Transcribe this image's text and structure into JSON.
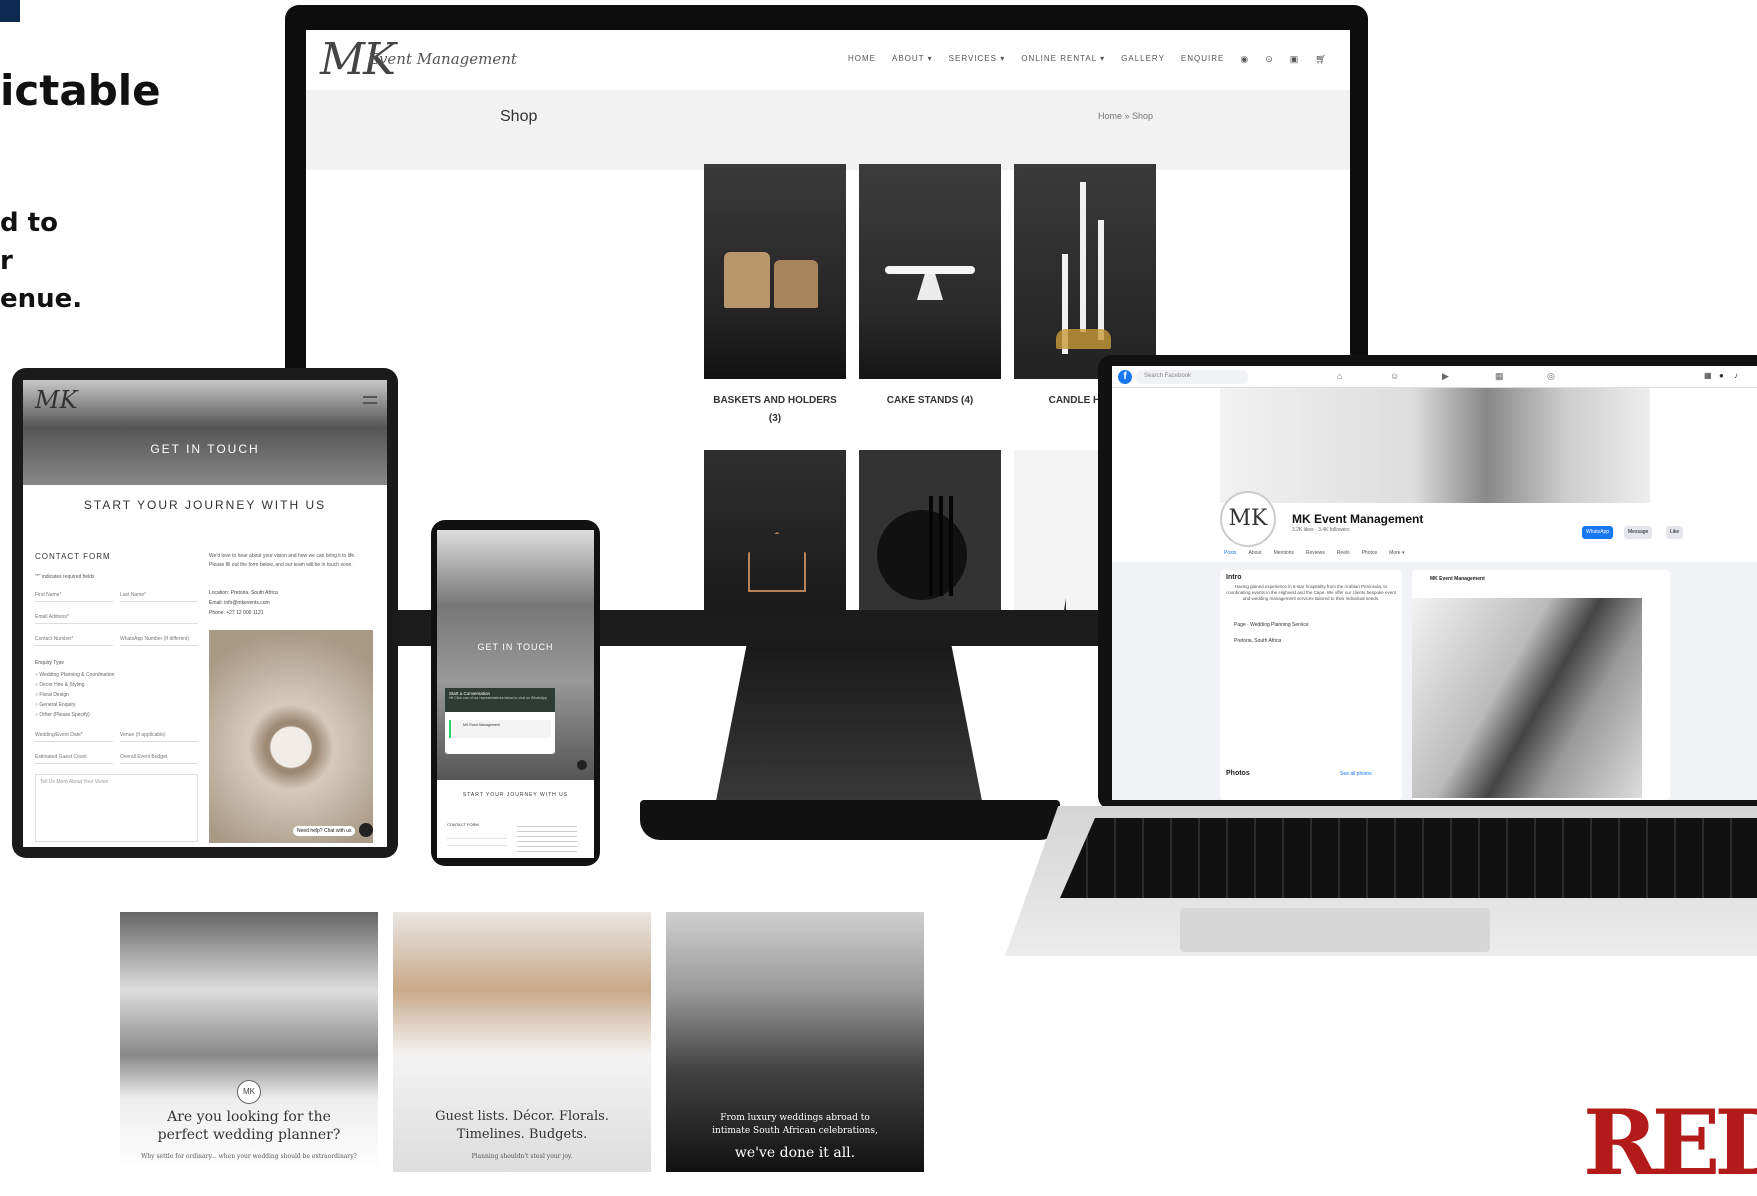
{
  "headline": {
    "line1": "ictable",
    "line2": "d to",
    "line3": "r",
    "line4": "enue."
  },
  "monitor": {
    "logo_mk": "MK",
    "logo_text": "Event Management",
    "nav": [
      "HOME",
      "ABOUT ▾",
      "SERVICES ▾",
      "ONLINE RENTAL ▾",
      "GALLERY",
      "ENQUIRE"
    ],
    "nav_icons": [
      "instagram-icon",
      "pinterest-icon",
      "youtube-icon",
      "cart-icon"
    ],
    "page_title": "Shop",
    "breadcrumb": "Home » Shop",
    "products": [
      {
        "label": "BASKETS AND HOLDERS",
        "count": "(3)"
      },
      {
        "label": "CAKE STANDS (4)"
      },
      {
        "label": "CANDLE HOLD"
      }
    ]
  },
  "facebook": {
    "search_placeholder": "Search Facebook",
    "page_name": "MK Event Management",
    "page_stats": "3.2K likes · 3.4K followers",
    "buttons": [
      "WhatsApp",
      "Message",
      "Like"
    ],
    "tabs": [
      "Posts",
      "About",
      "Mentions",
      "Reviews",
      "Reels",
      "Photos",
      "More ▾"
    ],
    "intro_title": "Intro",
    "intro_text": "Having gained experience in 5-star hospitality from the Arabian Peninsula, to coordinating events in the Highveld and the Cape. We offer our clients bespoke event and wedding management services tailored to their individual needs.",
    "intro_items": [
      "Page · Wedding Planning Service",
      "Pretoria, South Africa"
    ],
    "photos_label": "Photos",
    "see_all": "See all photos",
    "post_author": "MK Event Management",
    "avatar_text": "MK"
  },
  "tablet": {
    "hero_text": "GET IN TOUCH",
    "heading": "START YOUR JOURNEY WITH US",
    "form_title": "CONTACT FORM",
    "required_note": "\"*\" indicates required fields",
    "fields": [
      "First Name*",
      "Last Name*",
      "Email Address*",
      "Contact Number*",
      "WhatsApp Number (If different)"
    ],
    "enquiry_label": "Enquiry Type",
    "enquiry_options": [
      "Wedding Planning & Coordination",
      "Decor Hire & Styling",
      "Floral Design",
      "General Enquiry",
      "Other (Please Specify)"
    ],
    "fields2": [
      "Wedding/Event Date*",
      "Venue (If applicable)",
      "Estimated Guest Count",
      "Overall Event Budget"
    ],
    "message_placeholder": "Tell Us More About Your Vision",
    "intro_text": "We'd love to hear about your vision and how we can bring it to life. Please fill out the form below, and our team will be in touch soon.",
    "location": "Location: Pretoria, South Africa",
    "email": "Email: info@mkevents.com",
    "phone": "Phone: +27 12 000 1121",
    "chat_button": "Need help? Chat with us"
  },
  "phone": {
    "hero_text": "GET IN TOUCH",
    "chat_title": "Start a Conversation",
    "chat_sub": "Hi! Click one of our representatives below to chat on WhatsApp",
    "contact_name": "MK Event Management",
    "heading": "START YOUR JOURNEY WITH US",
    "form_title": "CONTACT FORM"
  },
  "social": [
    {
      "caption": "Are you looking for the perfect wedding planner?",
      "sub": "Why settle for ordinary... when your wedding should be extraordinary?"
    },
    {
      "caption": "Guest lists. Décor. Florals. Timelines. Budgets.",
      "sub": "Planning shouldn't steal your joy."
    },
    {
      "caption": "From luxury weddings abroad to intimate South African celebrations,",
      "sub": "we've done it all."
    }
  ],
  "brand_logo": "RED"
}
